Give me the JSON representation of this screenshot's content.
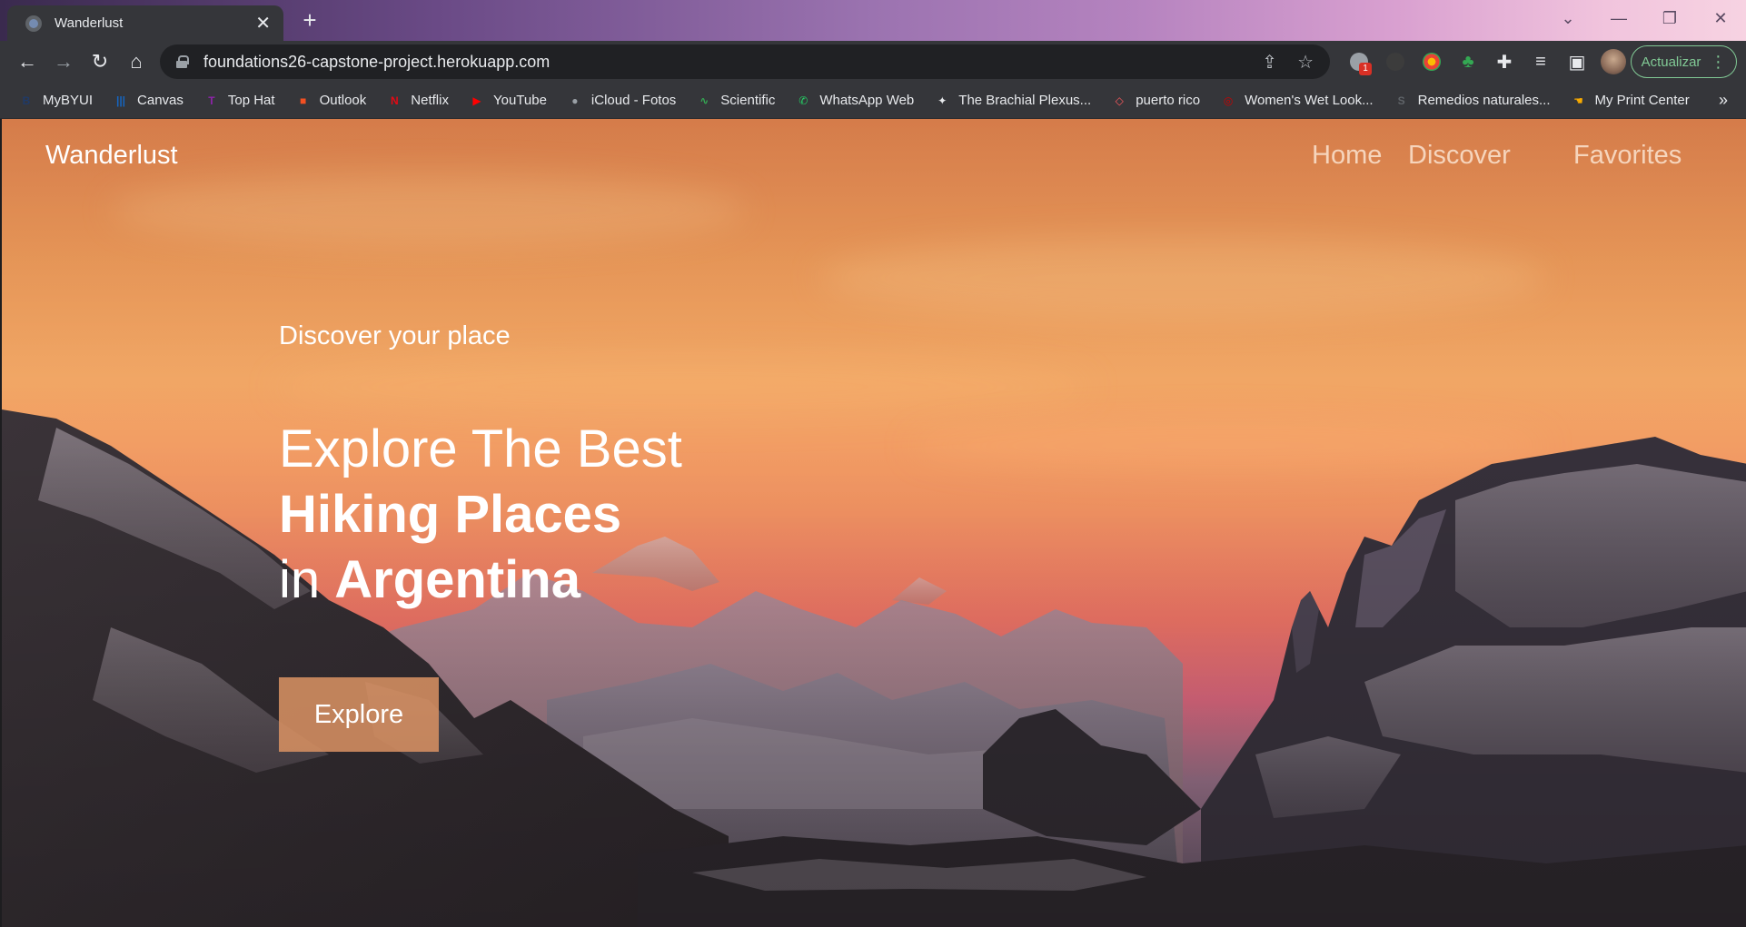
{
  "browser": {
    "tab_title": "Wanderlust",
    "url": "foundations26-capstone-project.herokuapp.com",
    "extension_badge": "1",
    "update_label": "Actualizar",
    "bookmarks": [
      {
        "label": "MyBYUI",
        "icon": "byui-icon",
        "color": "#1f3a68"
      },
      {
        "label": "Canvas",
        "icon": "canvas-icon",
        "color": "#1565c0"
      },
      {
        "label": "Top Hat",
        "icon": "tophat-icon",
        "color": "#8e24aa"
      },
      {
        "label": "Outlook",
        "icon": "microsoft-icon",
        "color": "#f25022"
      },
      {
        "label": "Netflix",
        "icon": "netflix-icon",
        "color": "#e50914"
      },
      {
        "label": "YouTube",
        "icon": "youtube-icon",
        "color": "#ff0000"
      },
      {
        "label": "iCloud - Fotos",
        "icon": "apple-icon",
        "color": "#9aa0a6"
      },
      {
        "label": "Scientific",
        "icon": "scientific-icon",
        "color": "#34a853"
      },
      {
        "label": "WhatsApp Web",
        "icon": "whatsapp-icon",
        "color": "#25d366"
      },
      {
        "label": "The Brachial Plexus...",
        "icon": "anatomy-icon",
        "color": "#e8eaed"
      },
      {
        "label": "puerto rico",
        "icon": "airbnb-icon",
        "color": "#ff5a5f"
      },
      {
        "label": "Women's Wet Look...",
        "icon": "target-icon",
        "color": "#cc0000"
      },
      {
        "label": "Remedios naturales...",
        "icon": "site-s-icon",
        "color": "#5f6368"
      },
      {
        "label": "My Print Center",
        "icon": "hand-icon",
        "color": "#f9ab00"
      }
    ],
    "bookmarks_more": "»"
  },
  "page": {
    "brand": "Wanderlust",
    "nav": {
      "home": "Home",
      "discover": "Discover",
      "favorites": "Favorites"
    },
    "hero": {
      "subtitle": "Discover your place",
      "line1": "Explore The Best",
      "line2": "Hiking Places",
      "line3_prefix": "in ",
      "line3_bold": "Argentina",
      "button": "Explore"
    }
  }
}
